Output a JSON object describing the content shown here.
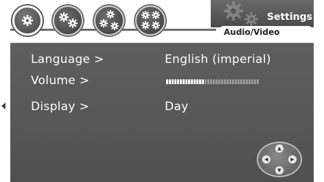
{
  "header": {
    "title": "Settings",
    "subtitle": "Audio/Video",
    "tabs": [
      {
        "icon": "gear-single-icon",
        "active": true
      },
      {
        "icon": "gear-double-icon",
        "active": false
      },
      {
        "icon": "gear-triple-icon",
        "active": false
      },
      {
        "icon": "gear-quad-icon",
        "active": false
      }
    ]
  },
  "settings": {
    "language": {
      "label": "Language >",
      "value": "English (imperial)"
    },
    "volume": {
      "label": "Volume >",
      "level": 0.42,
      "segments": 34
    },
    "display": {
      "label": "Display >",
      "value": "Day"
    }
  },
  "colors": {
    "panel": "#575757",
    "text": "#ffffff",
    "volume_on": "#ffffff",
    "volume_off": "#9a9a9a"
  }
}
